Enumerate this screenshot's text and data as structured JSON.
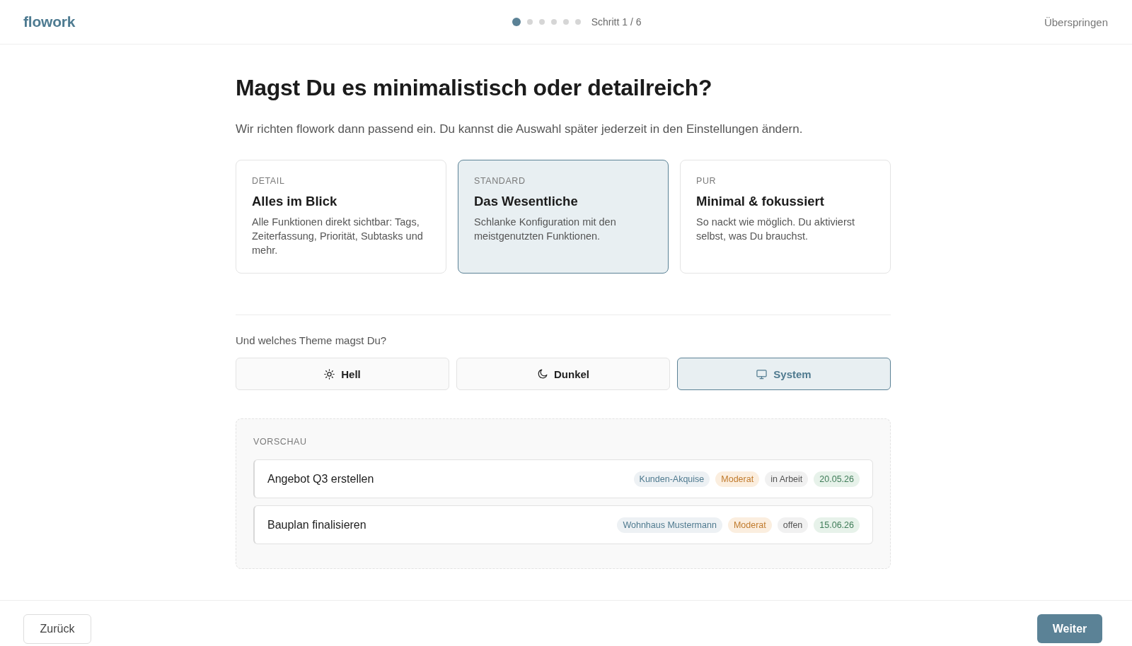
{
  "header": {
    "logo": "flowork",
    "progress": {
      "steps": [
        {
          "selected": true
        },
        {
          "selected": false
        },
        {
          "selected": false
        },
        {
          "selected": false
        },
        {
          "selected": false
        },
        {
          "selected": false
        }
      ],
      "label": "Schritt 1 / 6"
    },
    "skip_button": "Überspringen"
  },
  "question": {
    "title": "Magst Du es minimalistisch oder detailreich?",
    "subtitle": "Wir richten flowork dann passend ein. Du kannst die Auswahl später jederzeit in den Einstellungen ändern."
  },
  "detail_options": [
    {
      "label": "DETAIL",
      "title": "Alles im Blick",
      "description": "Alle Funktionen direkt sichtbar: Tags, Zeiterfassung, Priorität, Subtasks und mehr.",
      "selected": false
    },
    {
      "label": "STANDARD",
      "title": "Das Wesentliche",
      "description": "Schlanke Konfiguration mit den meistgenutzten Funktionen.",
      "selected": true
    },
    {
      "label": "PUR",
      "title": "Minimal & fokussiert",
      "description": "So nackt wie möglich. Du aktivierst selbst, was Du brauchst.",
      "selected": false
    }
  ],
  "theme": {
    "question": "Und welches Theme magst Du?",
    "options": [
      {
        "kind": "light",
        "label": "Hell",
        "selected": false
      },
      {
        "kind": "dark",
        "label": "Dunkel",
        "selected": false
      },
      {
        "kind": "system",
        "label": "System",
        "selected": true
      }
    ]
  },
  "preview": {
    "title": "VORSCHAU",
    "tasks": [
      {
        "title": "Angebot Q3 erstellen",
        "tags": [
          {
            "kind": "project",
            "text": "Kunden-Akquise"
          },
          {
            "kind": "priority",
            "text": "Moderat"
          },
          {
            "kind": "status",
            "text": "in Arbeit"
          },
          {
            "kind": "date",
            "text": "20.05.26"
          }
        ]
      },
      {
        "title": "Bauplan finalisieren",
        "tags": [
          {
            "kind": "project",
            "text": "Wohnhaus Mustermann"
          },
          {
            "kind": "priority",
            "text": "Moderat"
          },
          {
            "kind": "status",
            "text": "offen"
          },
          {
            "kind": "date",
            "text": "15.06.26"
          }
        ]
      }
    ]
  },
  "footer": {
    "back_button": "Zurück",
    "next_button": "Weiter"
  }
}
